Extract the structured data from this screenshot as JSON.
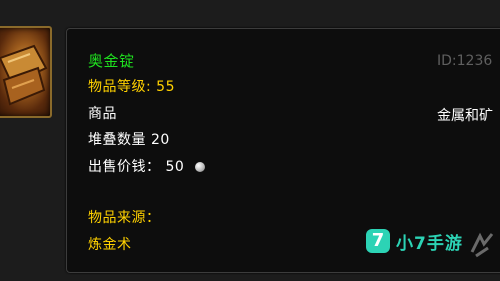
{
  "item": {
    "name": "奥金锭",
    "item_level": "物品等级: 55",
    "category": "商品",
    "stack_size": "堆叠数量 20",
    "sell_price_label": "出售价钱：",
    "sell_price_value": "50",
    "sell_currency_icon": "silver-coin-icon",
    "source_label": "物品来源：",
    "source_value": "炼金术",
    "id_text": "ID:1236",
    "type_text": "金属和矿"
  },
  "watermark": {
    "logo_char": "7",
    "text": "小7手游"
  },
  "colors": {
    "item_name": "#1fe01f",
    "gold_text": "#ffd100",
    "white_text": "#ffffff",
    "id_text": "#5f5f5f",
    "watermark": "#2cd3b5",
    "panel_bg": "#0d0d0d"
  }
}
